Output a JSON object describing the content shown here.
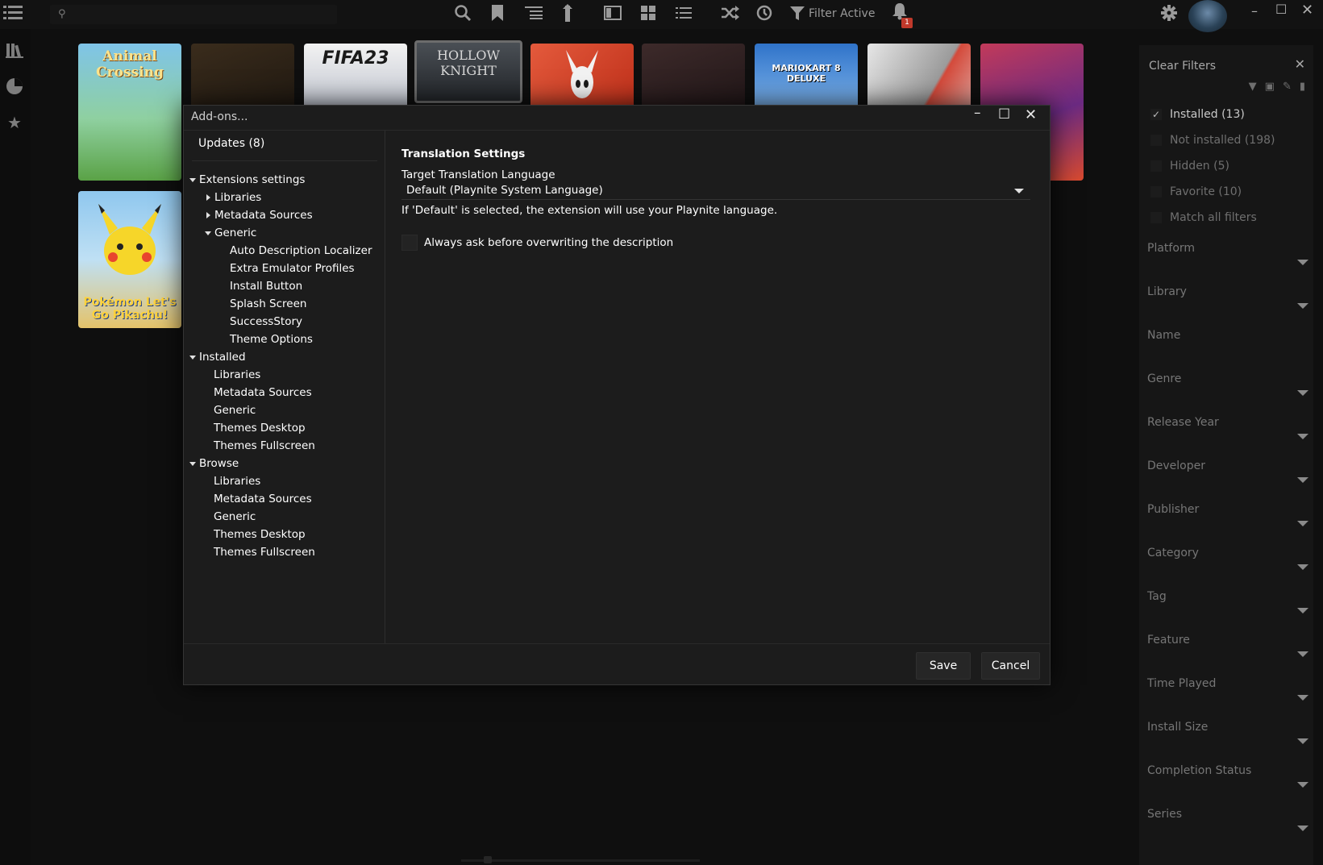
{
  "topbar": {
    "filter_active_label": "Filter Active",
    "notification_count": "1",
    "icons": [
      "menu-icon",
      "search-icon",
      "bookmark-icon",
      "group-list-icon",
      "sort-icon",
      "details-view-icon",
      "grid-view-icon",
      "list-view-icon",
      "shuffle-icon",
      "clock-icon",
      "filter-icon",
      "bell-icon"
    ]
  },
  "leftrail": {
    "icons": [
      "library-icon",
      "stats-pie-icon",
      "star-icon"
    ]
  },
  "games": [
    {
      "title": "Animal Crossing"
    },
    {
      "title": ""
    },
    {
      "title": "FIFA23"
    },
    {
      "title": "HOLLOW KNIGHT"
    },
    {
      "title": ""
    },
    {
      "title": ""
    },
    {
      "title": "MARIOKART 8 DELUXE"
    },
    {
      "title": ""
    },
    {
      "title": ""
    },
    {
      "title": "Pokémon Let's Go Pikachu!"
    }
  ],
  "filters": {
    "clear_label": "Clear Filters",
    "checks": [
      {
        "label": "Installed (13)",
        "checked": true
      },
      {
        "label": "Not installed (198)",
        "checked": false
      },
      {
        "label": "Hidden (5)",
        "checked": false
      },
      {
        "label": "Favorite (10)",
        "checked": false
      },
      {
        "label": "Match all filters",
        "checked": false
      }
    ],
    "sections": [
      "Platform",
      "Library",
      "Name",
      "Genre",
      "Release Year",
      "Developer",
      "Publisher",
      "Category",
      "Tag",
      "Feature",
      "Time Played",
      "Install Size",
      "Completion Status",
      "Series"
    ]
  },
  "dialog": {
    "title": "Add-ons...",
    "updates_label": "Updates (8)",
    "tree": {
      "ext_settings": "Extensions settings",
      "ext_libraries": "Libraries",
      "ext_metadata": "Metadata Sources",
      "ext_generic": "Generic",
      "ext_generic_children": [
        "Auto Description Localizer",
        "Extra Emulator Profiles",
        "Install Button",
        "Splash Screen",
        "SuccessStory",
        "Theme Options"
      ],
      "installed": "Installed",
      "installed_children": [
        "Libraries",
        "Metadata Sources",
        "Generic",
        "Themes Desktop",
        "Themes Fullscreen"
      ],
      "browse": "Browse",
      "browse_children": [
        "Libraries",
        "Metadata Sources",
        "Generic",
        "Themes Desktop",
        "Themes Fullscreen"
      ]
    },
    "settings": {
      "heading": "Translation Settings",
      "language_label": "Target Translation Language",
      "language_value": "Default (Playnite System Language)",
      "hint": "If 'Default' is selected, the extension will use your Playnite language.",
      "overwrite_label": "Always ask before overwriting the description",
      "overwrite_checked": false
    },
    "save_label": "Save",
    "cancel_label": "Cancel"
  }
}
